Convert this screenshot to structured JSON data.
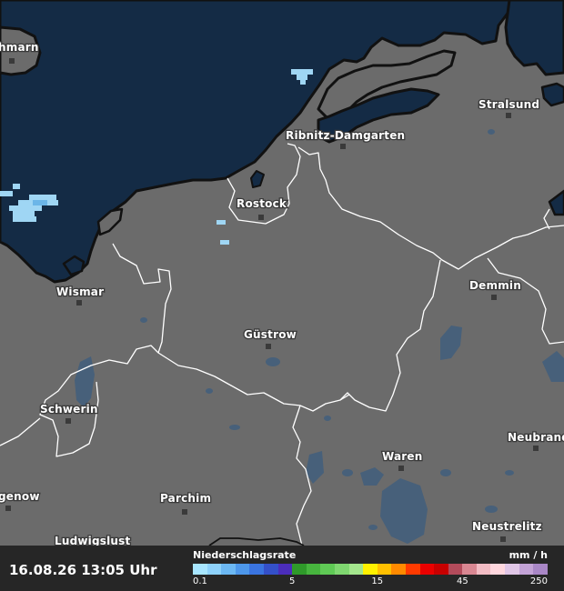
{
  "map": {
    "colors": {
      "land": "#6b6b6b",
      "sea": "#142b45",
      "coast": "#111111",
      "border": "#ffffff",
      "lake": "#47607a",
      "precip_light": "#9fd6f4",
      "precip_mid": "#6cb6e8"
    },
    "cities": [
      {
        "id": "fehmarn",
        "name": "hmarn"
      },
      {
        "id": "stralsund",
        "name": "Stralsund"
      },
      {
        "id": "ribnitz",
        "name": "Ribnitz-Damgarten"
      },
      {
        "id": "rostock",
        "name": "Rostock"
      },
      {
        "id": "wismar",
        "name": "Wismar"
      },
      {
        "id": "demmin",
        "name": "Demmin"
      },
      {
        "id": "guestrow",
        "name": "Güstrow"
      },
      {
        "id": "schwerin",
        "name": "Schwerin"
      },
      {
        "id": "neubrandenburg",
        "name": "Neubrand"
      },
      {
        "id": "waren",
        "name": "Waren"
      },
      {
        "id": "grabow",
        "name": "genow"
      },
      {
        "id": "parchim",
        "name": "Parchim"
      },
      {
        "id": "neustrelitz",
        "name": "Neustrelitz"
      },
      {
        "id": "ludwigslust",
        "name": "Ludwigslust"
      }
    ]
  },
  "footer": {
    "timestamp": "16.08.26 13:05 Uhr",
    "legend_title": "Niederschlagsrate",
    "legend_unit": "mm / h",
    "scale_colors": [
      "#a8e6ff",
      "#8ed2fb",
      "#6cb8f3",
      "#4d97ea",
      "#3a74e0",
      "#3450c9",
      "#4b2dbb",
      "#2f9a2a",
      "#47b53e",
      "#5fca55",
      "#7fd770",
      "#a4e68d",
      "#fff100",
      "#ffc000",
      "#ff8a00",
      "#ff3a00",
      "#ea0000",
      "#c80000",
      "#b34b5b",
      "#d98792",
      "#f2bcc4",
      "#ffd7de",
      "#e0c6e6",
      "#c3a3d6",
      "#a987c6"
    ],
    "scale_ticks": [
      {
        "label": "0.1",
        "pos": 0.0
      },
      {
        "label": "5",
        "pos": 0.28
      },
      {
        "label": "15",
        "pos": 0.52
      },
      {
        "label": "45",
        "pos": 0.76
      },
      {
        "label": "250",
        "pos": 1.0
      }
    ]
  }
}
